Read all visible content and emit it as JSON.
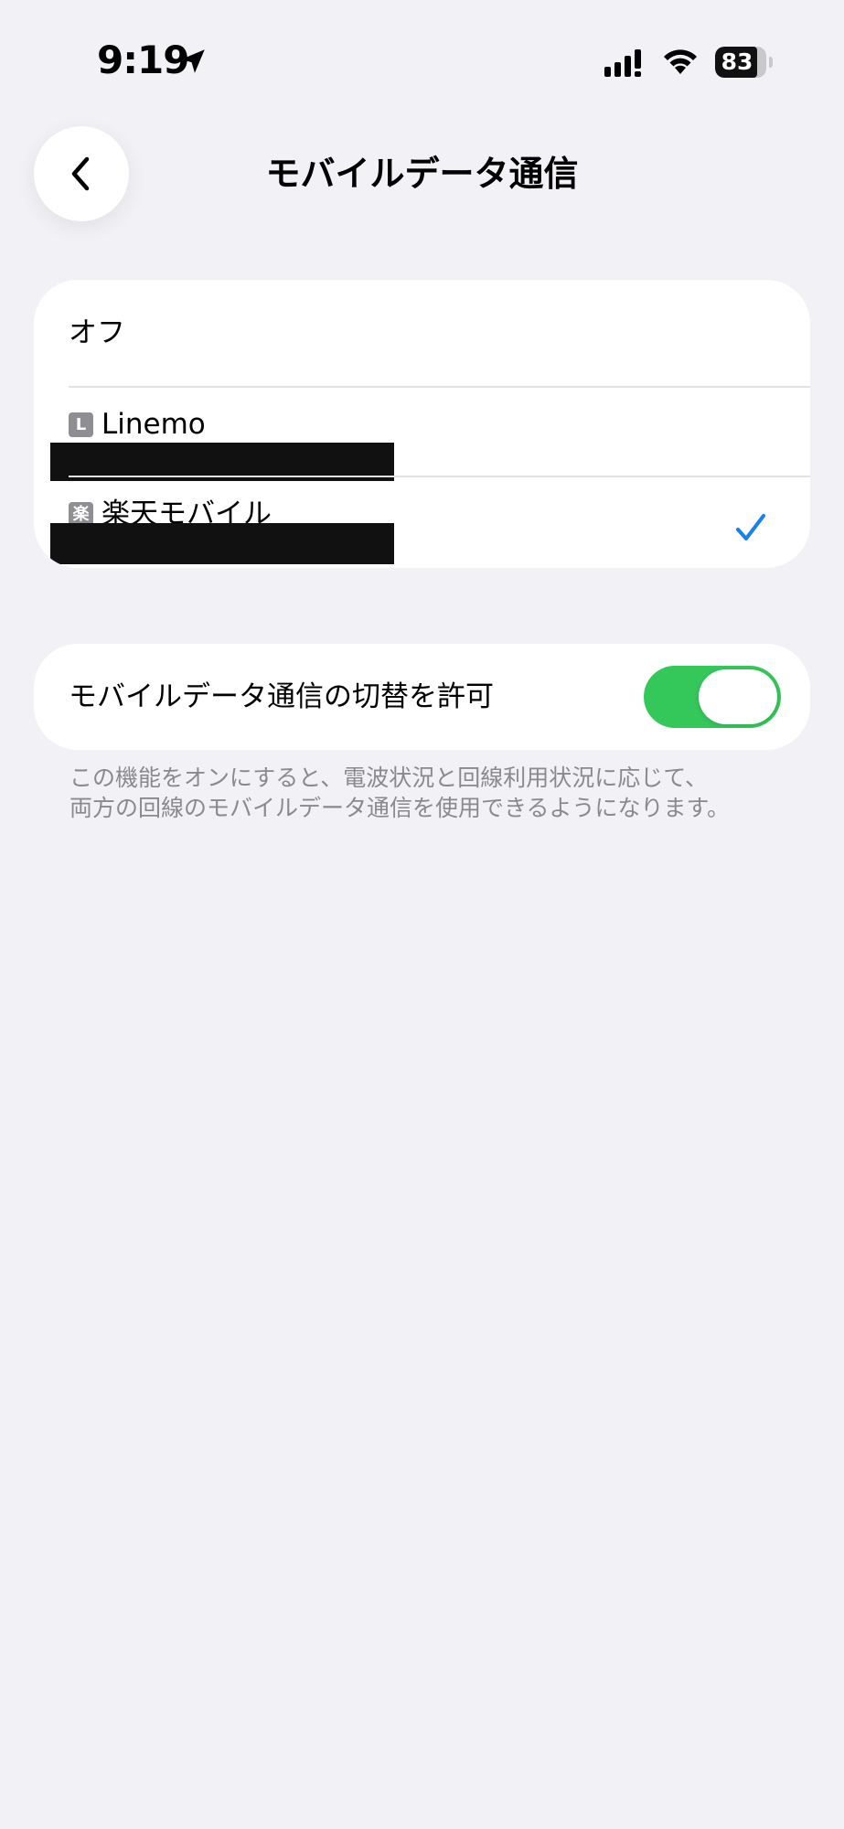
{
  "status_bar": {
    "time": "9:19",
    "battery_level": 83,
    "battery_label": "83",
    "icons": [
      "location-arrow-icon",
      "cellular-signal-icon",
      "wifi-icon",
      "battery-icon"
    ]
  },
  "nav": {
    "back_icon": "chevron-left-icon",
    "title": "モバイルデータ通信"
  },
  "carrier_options": {
    "off_label": "オフ",
    "items": [
      {
        "badge": "L",
        "name": "Linemo",
        "selected": false
      },
      {
        "badge": "楽",
        "name": "楽天モバイル",
        "selected": true
      }
    ],
    "check_icon": "checkmark-icon",
    "accent_color": "#1a7ff0"
  },
  "switching": {
    "label": "モバイルデータ通信の切替を許可",
    "enabled": true,
    "switch_color": "#34c759",
    "footnote_lines": [
      "この機能をオンにすると、電波状況と回線利用状況に応じて、",
      "両方の回線のモバイルデータ通信を使用できるようになります。"
    ]
  }
}
